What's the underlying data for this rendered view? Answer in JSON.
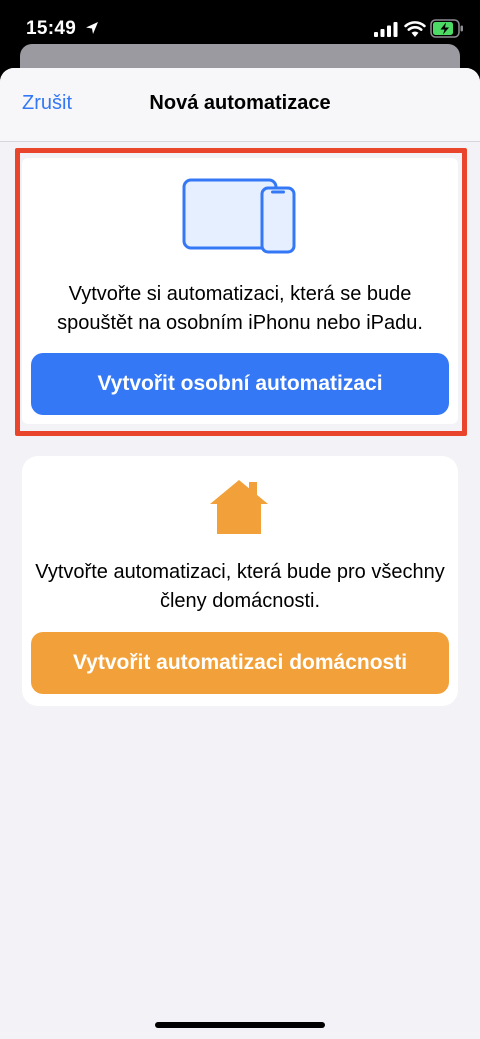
{
  "status": {
    "time": "15:49"
  },
  "nav": {
    "cancel_label": "Zrušit",
    "title": "Nová automatizace"
  },
  "personal": {
    "description": "Vytvořte si automatizaci, která se bude spouštět na osobním iPhonu nebo iPadu.",
    "button_label": "Vytvořit osobní automatizaci",
    "icon": "ipad-iphone-icon",
    "accent_color": "#3478f6"
  },
  "home": {
    "description": "Vytvořte automatizaci, která bude pro všechny členy domácnosti.",
    "button_label": "Vytvořit automatizaci domácnosti",
    "icon": "house-icon",
    "accent_color": "#f2a13a"
  },
  "highlight_color": "#e8452c"
}
